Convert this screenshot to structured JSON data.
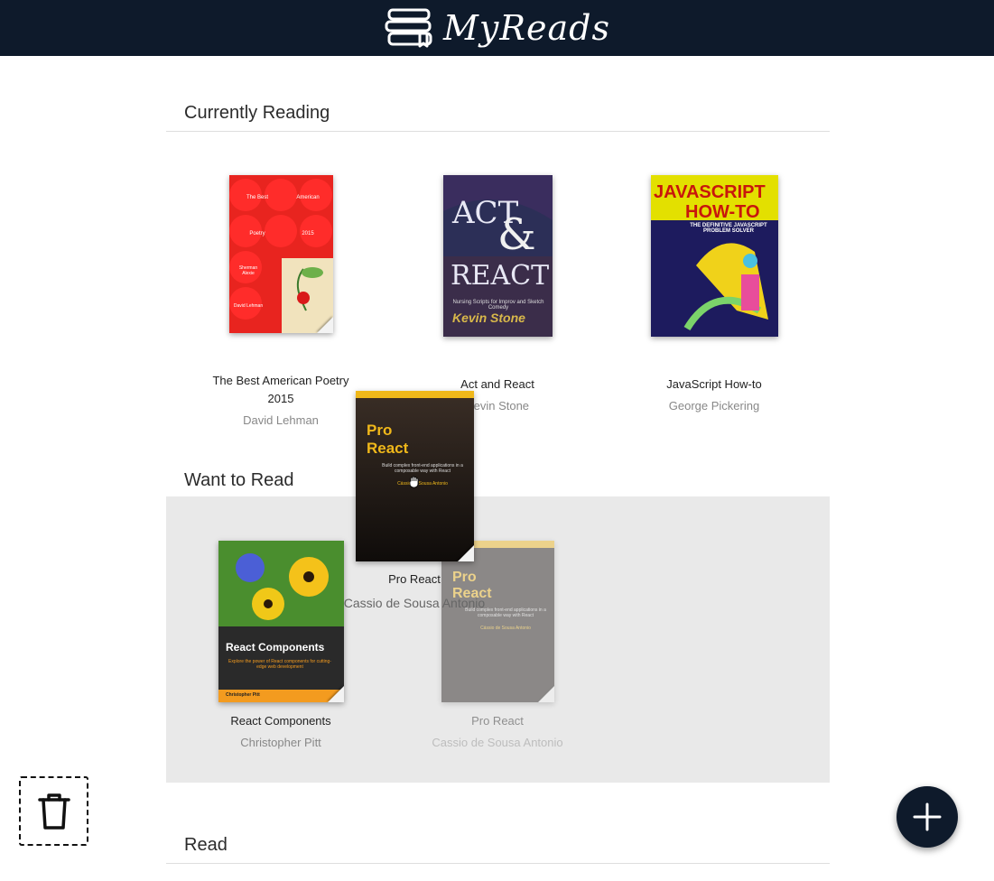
{
  "header": {
    "app_title": "MyReads",
    "logo_icon": "books-stack-icon"
  },
  "shelves": [
    {
      "title": "Currently Reading",
      "books": [
        {
          "title": "The Best American Poetry 2015",
          "author": "David Lehman",
          "cover_lines": [
            "The Best",
            "American",
            "Poetry",
            "2015",
            "Sherman Alexie",
            "David Lehman"
          ]
        },
        {
          "title": "Act and React",
          "author": "Kevin Stone",
          "cover_lines": [
            "ACT",
            "&",
            "REACT",
            "Nursing Scripts for Improv and Sketch Comedy",
            "Kevin Stone"
          ]
        },
        {
          "title": "JavaScript How-to",
          "author": "George Pickering",
          "cover_lines": [
            "JAVASCRIPT",
            "HOW-TO",
            "THE DEFINITIVE JAVASCRIPT PROBLEM SOLVER"
          ]
        }
      ]
    },
    {
      "title": "Want to Read",
      "books": [
        {
          "title": "React Components",
          "author": "Christopher Pitt",
          "cover_lines": [
            "React Components",
            "Explore the power of React components for cutting-edge web development",
            "Christopher Pitt"
          ]
        },
        {
          "title": "Pro React",
          "author": "Cassio de Sousa Antonio",
          "cover_lines": [
            "Pro",
            "React",
            "Build complex front-end applications in a composable way with React",
            "Cássio de Sousa Antonio"
          ]
        }
      ]
    },
    {
      "title": "Read",
      "books": []
    }
  ],
  "dragging": {
    "title": "Pro React",
    "author": "Cassio de Sousa Antonio",
    "cover_lines": [
      "Pro",
      "React",
      "Build complex front-end applications in a composable way with React",
      "Cássio de Sousa Antonio"
    ]
  },
  "actions": {
    "trash_icon": "trash-icon",
    "add_icon": "plus-icon"
  },
  "colors": {
    "header_bg": "#0e1a2b",
    "drop_zone_bg": "#e9e9e9"
  }
}
